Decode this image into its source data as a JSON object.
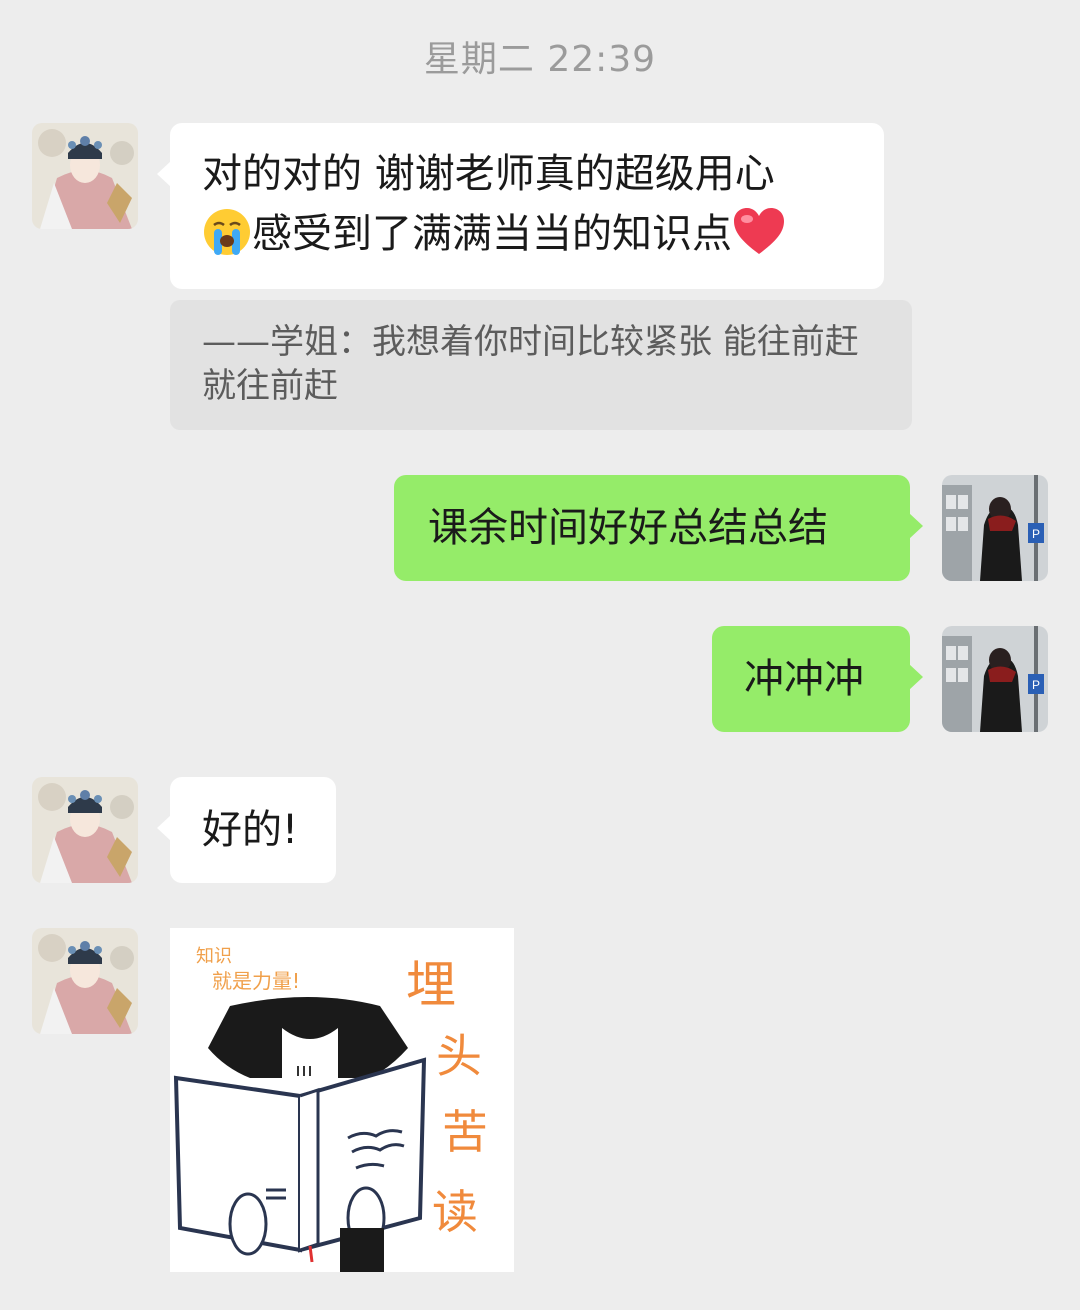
{
  "timestamp": "星期二 22:39",
  "messages": [
    {
      "side": "left",
      "line1": "对的对的 谢谢老师真的超级用心",
      "line2": "感受到了满满当当的知识点",
      "emoji_before": "crying-face-icon",
      "emoji_after": "heart-icon",
      "quote": "——学姐：我想着你时间比较紧张 能往前赶就往前赶"
    },
    {
      "side": "right",
      "text": "课余时间好好总结总结"
    },
    {
      "side": "right",
      "text": "冲冲冲"
    },
    {
      "side": "left",
      "text": "好的!"
    },
    {
      "side": "left",
      "sticker": {
        "top_text_1": "知识",
        "top_text_2": "就是力量!",
        "vertical_text": [
          "埋",
          "头",
          "苦",
          "读"
        ]
      }
    }
  ],
  "colors": {
    "background": "#ededed",
    "left_bubble": "#ffffff",
    "right_bubble": "#95ec69",
    "quote_bg": "#e2e2e2",
    "timestamp": "#9b9b9b",
    "sticker_orange": "#f08a3c"
  }
}
